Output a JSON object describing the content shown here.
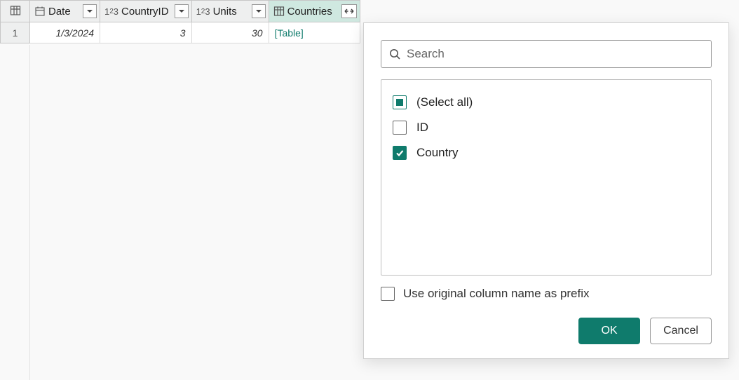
{
  "columns": {
    "date": {
      "label": "Date"
    },
    "countryid": {
      "label": "CountryID"
    },
    "units": {
      "label": "Units"
    },
    "countries": {
      "label": "Countries"
    }
  },
  "rows": [
    {
      "num": "1",
      "date": "1/3/2024",
      "countryid": "3",
      "units": "30",
      "countries": "[Table]"
    }
  ],
  "popup": {
    "search_placeholder": "Search",
    "select_all_label": "(Select all)",
    "options": {
      "id": {
        "label": "ID"
      },
      "country": {
        "label": "Country"
      }
    },
    "prefix_label": "Use original column name as prefix",
    "ok_label": "OK",
    "cancel_label": "Cancel"
  }
}
